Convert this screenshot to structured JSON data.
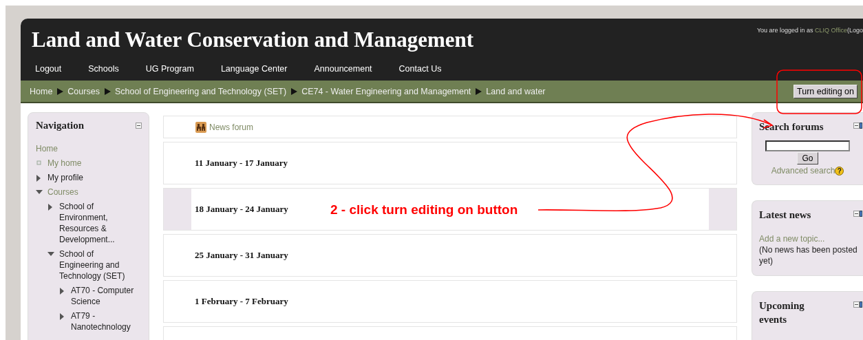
{
  "header": {
    "title": "Land and Water Conservation and Management",
    "login": {
      "prefix": "You are logged in as ",
      "user": "CLIQ Office",
      "suffix": "(Logo"
    }
  },
  "menu": [
    "Logout",
    "Schools",
    "UG Program",
    "Language Center",
    "Announcement",
    "Contact Us"
  ],
  "breadcrumb": [
    "Home",
    "Courses",
    "School of Engineering and Technology (SET)",
    "CE74 - Water Engineering and Management",
    "Land and water"
  ],
  "edit_button": "Turn editing on",
  "navigation": {
    "title": "Navigation",
    "items": [
      {
        "label": "Home",
        "kind": "plain",
        "link": true
      },
      {
        "label": "My home",
        "kind": "leaf",
        "link": true
      },
      {
        "label": "My profile",
        "kind": "branch",
        "expanded": false,
        "link": false
      },
      {
        "label": "Courses",
        "kind": "branch",
        "expanded": true,
        "link": true,
        "children": [
          {
            "label": "School of Environment, Resources & Development...",
            "kind": "branch",
            "expanded": false,
            "link": false
          },
          {
            "label": "School of Engineering and Technology (SET)",
            "kind": "branch",
            "expanded": true,
            "link": false,
            "children": [
              {
                "label": "AT70 - Computer Science",
                "kind": "branch",
                "expanded": false,
                "link": false
              },
              {
                "label": "AT79 - Nanotechnology",
                "kind": "branch",
                "expanded": false,
                "link": false
              }
            ]
          }
        ]
      }
    ]
  },
  "course": {
    "news_forum": "News forum",
    "sections": [
      {
        "title": "11 January - 17 January",
        "current": false
      },
      {
        "title": "18 January - 24 January",
        "current": true
      },
      {
        "title": "25 January - 31 January",
        "current": false
      },
      {
        "title": "1 February - 7 February",
        "current": false
      },
      {
        "current": false
      }
    ]
  },
  "search_forums": {
    "title": "Search forums",
    "button": "Go",
    "link": "Advanced search",
    "help": "?"
  },
  "latest_news": {
    "title": "Latest news",
    "link": "Add a new topic...",
    "message": "(No news has been posted yet)"
  },
  "upcoming_events": {
    "title": "Upcoming events"
  },
  "annotation": {
    "text": "2 - click turn editing on button"
  }
}
